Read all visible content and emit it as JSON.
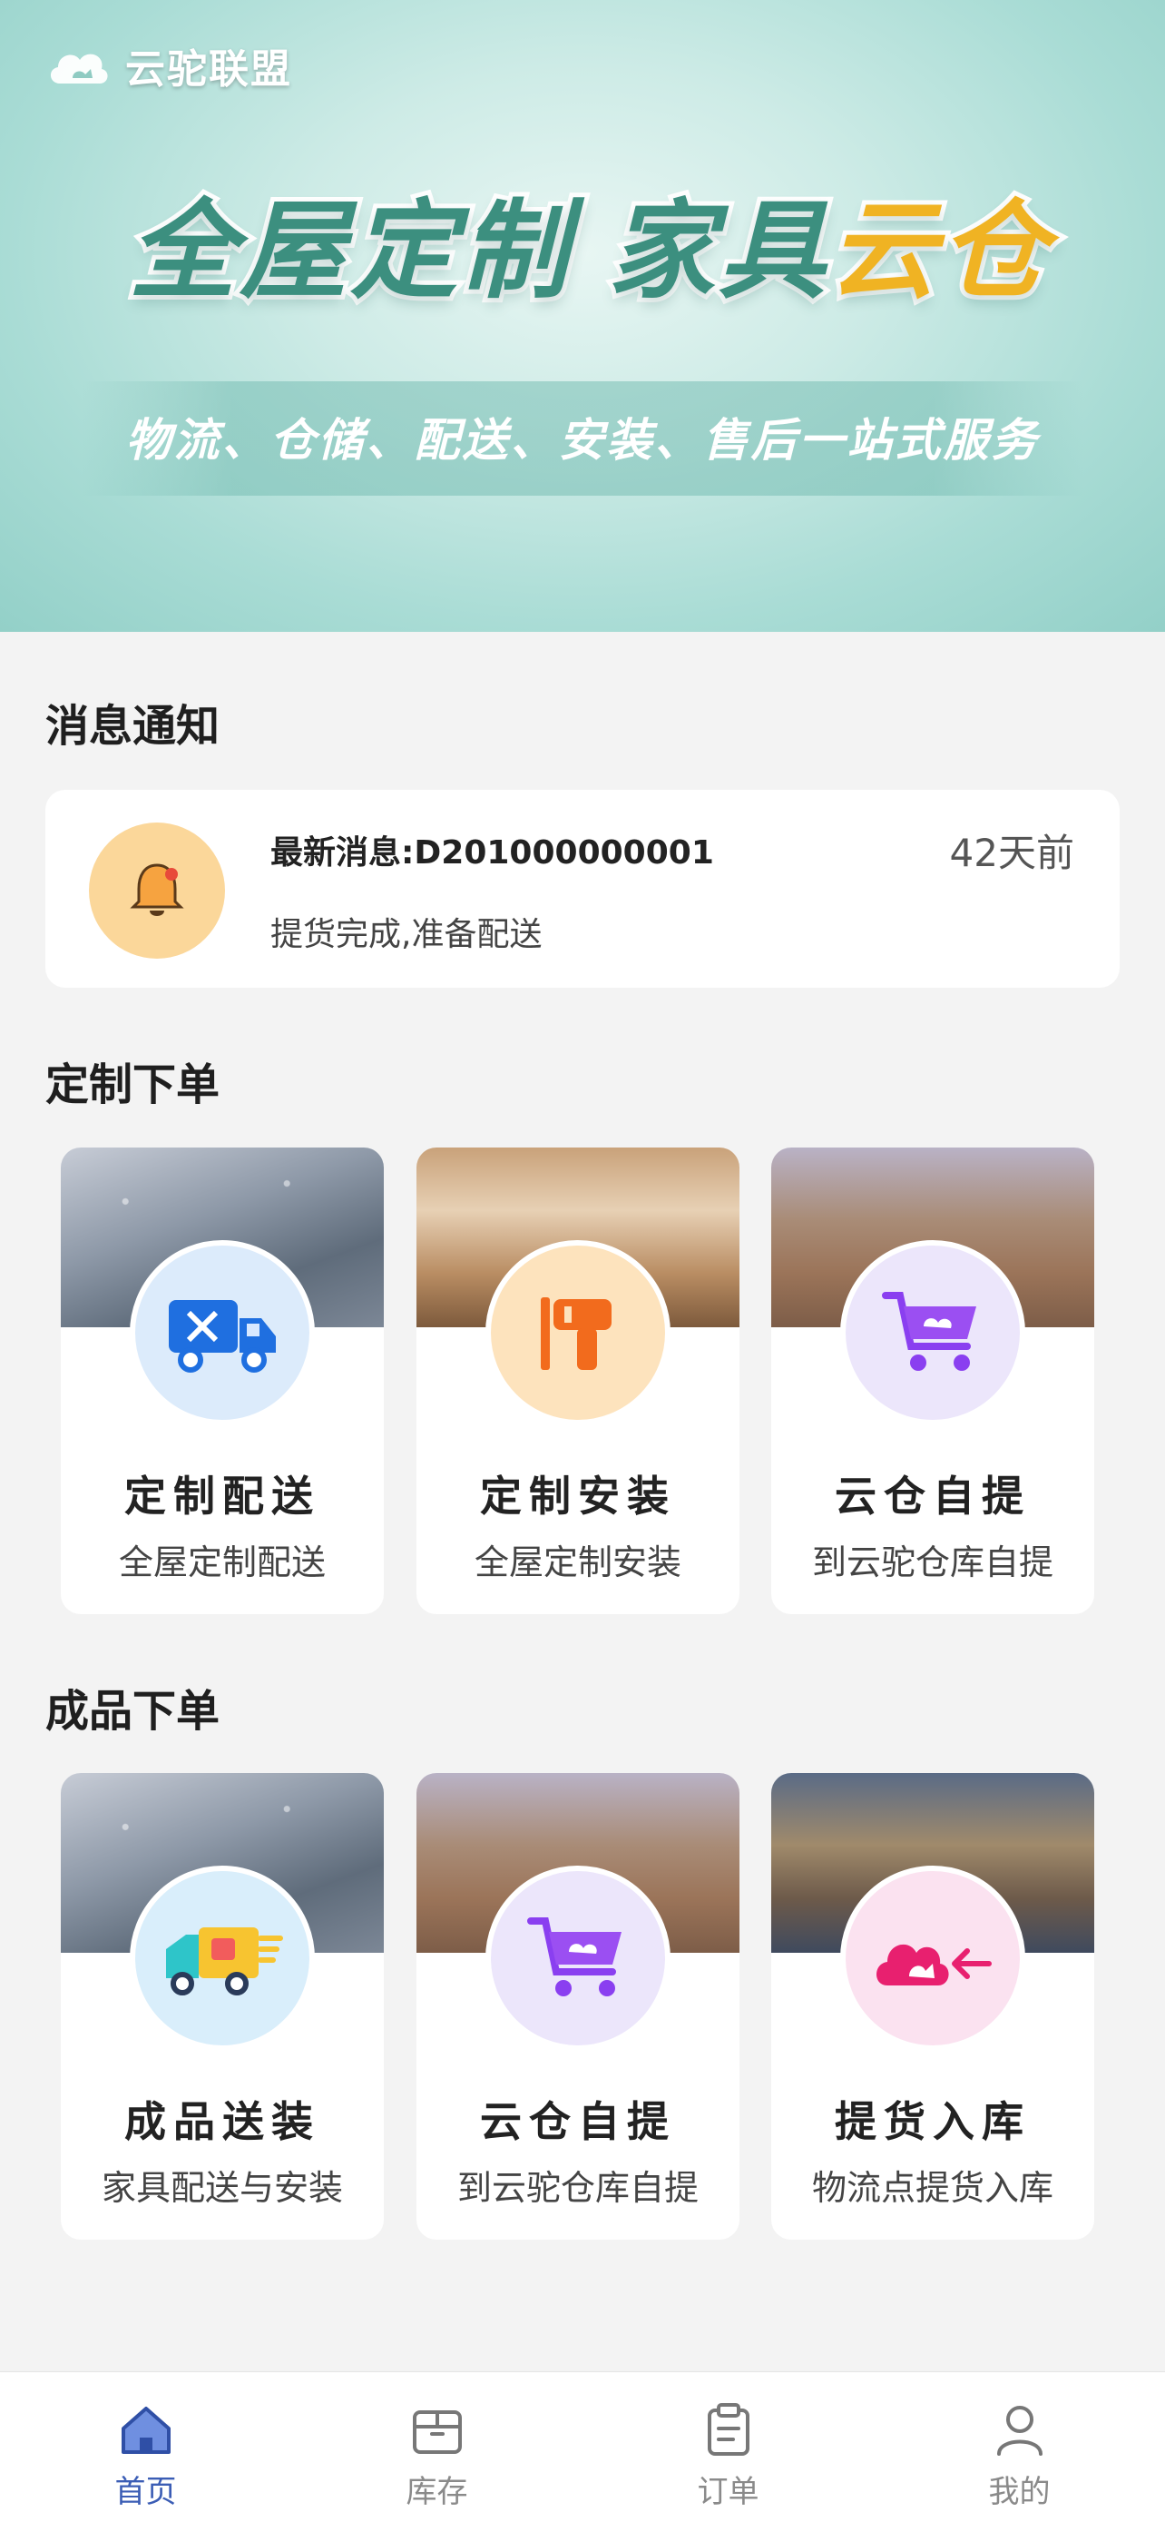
{
  "banner": {
    "brand": "云驼联盟",
    "headline_part1": "全屋定制",
    "headline_part2a": "家具",
    "headline_part2b": "云仓",
    "subline": "物流、仓储、配送、安装、售后一站式服务"
  },
  "notifications": {
    "section_title": "消息通知",
    "latest": {
      "title": "最新消息:D201000000001",
      "time": "42天前",
      "body": "提货完成,准备配送"
    }
  },
  "custom_order": {
    "section_title": "定制下单",
    "cards": [
      {
        "title": "定制配送",
        "subtitle": "全屋定制配送",
        "icon": "delivery-truck-icon"
      },
      {
        "title": "定制安装",
        "subtitle": "全屋定制安装",
        "icon": "drill-icon"
      },
      {
        "title": "云仓自提",
        "subtitle": "到云驼仓库自提",
        "icon": "cart-icon"
      }
    ]
  },
  "finished_order": {
    "section_title": "成品下单",
    "cards": [
      {
        "title": "成品送装",
        "subtitle": "家具配送与安装",
        "icon": "fast-truck-icon"
      },
      {
        "title": "云仓自提",
        "subtitle": "到云驼仓库自提",
        "icon": "cart-icon"
      },
      {
        "title": "提货入库",
        "subtitle": "物流点提货入库",
        "icon": "cloud-inbound-icon"
      }
    ]
  },
  "tabbar": {
    "items": [
      {
        "label": "首页",
        "icon": "home-icon",
        "active": true
      },
      {
        "label": "库存",
        "icon": "box-icon",
        "active": false
      },
      {
        "label": "订单",
        "icon": "clipboard-icon",
        "active": false
      },
      {
        "label": "我的",
        "icon": "user-icon",
        "active": false
      }
    ]
  },
  "colors": {
    "accent": "#3b5db5",
    "banner_green": "#3c8f7f",
    "banner_yellow": "#f0b323"
  }
}
